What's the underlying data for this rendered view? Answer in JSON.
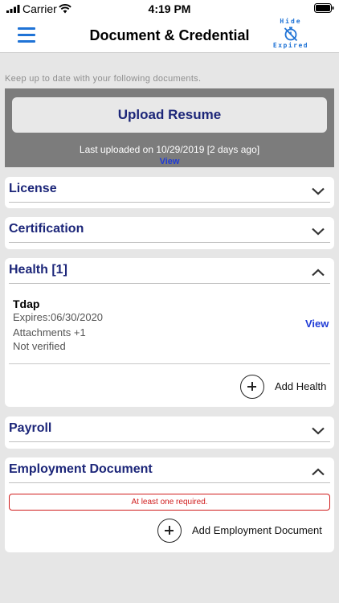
{
  "status_bar": {
    "carrier": "Carrier",
    "time": "4:19 PM"
  },
  "nav": {
    "title": "Document & Credential",
    "hide_label": "Hide",
    "expired_label": "Expired",
    "menu_icon": "hamburger-menu-icon",
    "hide_icon": "stopwatch-slash-icon"
  },
  "intro": "Keep up to date with your following documents.",
  "upload": {
    "button_label": "Upload Resume",
    "last_uploaded": "Last uploaded on 10/29/2019 [2 days ago]",
    "view_label": "View"
  },
  "sections": {
    "license": {
      "title": "License",
      "expanded": false
    },
    "certification": {
      "title": "Certification",
      "expanded": false
    },
    "health": {
      "title": "Health [1]",
      "expanded": true,
      "item": {
        "name": "Tdap",
        "expires": "Expires:06/30/2020",
        "attachments": "Attachments +1",
        "status": "Not verified",
        "view_label": "View"
      },
      "add_label": "Add Health"
    },
    "payroll": {
      "title": "Payroll",
      "expanded": false
    },
    "employment": {
      "title": "Employment Document",
      "expanded": true,
      "warning": "At least one required.",
      "add_label": "Add Employment Document"
    }
  },
  "colors": {
    "accent": "#1f73d6",
    "section_title": "#1c2679",
    "link": "#1f3bd6",
    "warning": "#d01c1c",
    "upload_panel": "#7c7c7c",
    "background": "#e6e6e6"
  }
}
